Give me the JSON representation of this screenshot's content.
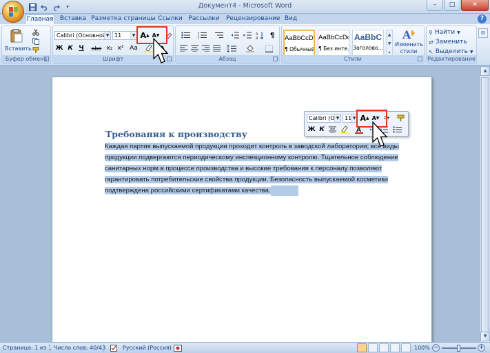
{
  "window": {
    "title": "Документ4 - Microsoft Word",
    "controls": [
      "–",
      "□",
      "✕"
    ]
  },
  "qat": {
    "items": [
      "save-icon",
      "undo-icon",
      "redo-icon",
      "customize-icon"
    ]
  },
  "tabs": [
    {
      "label": "Главная",
      "active": true
    },
    {
      "label": "Вставка"
    },
    {
      "label": "Разметка страницы"
    },
    {
      "label": "Ссылки"
    },
    {
      "label": "Рассылки"
    },
    {
      "label": "Рецензирование"
    },
    {
      "label": "Вид"
    }
  ],
  "ribbon": {
    "clipboard": {
      "label": "Буфер обмена",
      "paste": "Вставить"
    },
    "font": {
      "label": "Шрифт",
      "font_name": "Calibri (Основной те",
      "font_size": "11",
      "grow": "A",
      "shrink": "A",
      "bold": "Ж",
      "italic": "К",
      "underline": "Ч",
      "strike": "abe",
      "subscript": "x₂",
      "superscript": "x²",
      "change_case": "Aa"
    },
    "paragraph": {
      "label": "Абзац"
    },
    "styles": {
      "label": "Стили",
      "tiles": [
        {
          "sample": "AaBbCcDc",
          "name": "¶ Обычный"
        },
        {
          "sample": "AaBbCcDc",
          "name": "¶ Без инте..."
        },
        {
          "sample": "AaBbC",
          "name": "Заголово..."
        }
      ],
      "change_styles": [
        "Изменить",
        "стили"
      ]
    },
    "editing": {
      "label": "Редактирование",
      "find": "Найти",
      "replace": "Заменить",
      "select": "Выделить"
    }
  },
  "minibar": {
    "font_name": "Calibri (Ос",
    "font_size": "11",
    "grow": "A",
    "shrink": "A",
    "bold": "Ж",
    "italic": "К"
  },
  "document": {
    "heading": "Требования к производству",
    "lines": [
      "Каждая партия выпускаемой продукции проходит контроль в заводской лаборатории; все виды",
      "продукции подвергаются периодическому инспекционному контролю. Тщательное соблюдение",
      "санитарных норм в процессе производства и высокие требования к персоналу позволяют",
      "гарантировать потребительские свойства продукции. Безопасность выпускаемой косметики",
      "подтверждена российскими сертификатами качества."
    ]
  },
  "statusbar": {
    "page": "Страница: 1 из 1",
    "words": "Число слов: 40/43",
    "language": "Русский (Россия)",
    "zoom": "100%"
  }
}
